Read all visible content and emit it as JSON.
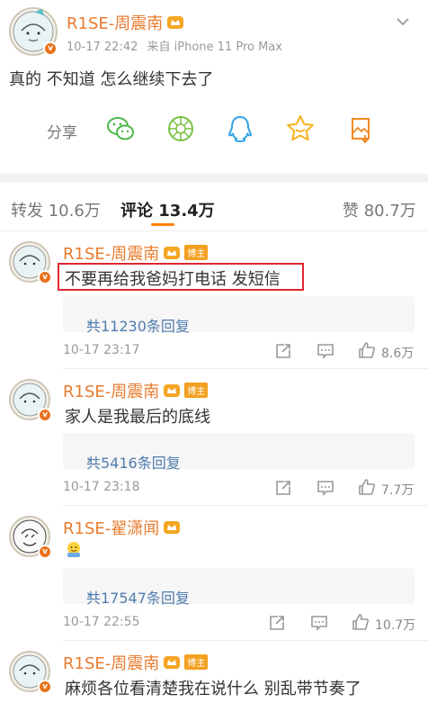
{
  "post": {
    "author": "R1SE-周震南",
    "time": "10-17 22:42",
    "source": "来自 iPhone 11 Pro Max",
    "text": "真的 不知道 怎么继续下去了",
    "share_label": "分享"
  },
  "tabs": {
    "repost": "转发 10.6万",
    "comments": "评论 13.4万",
    "likes": "赞 80.7万"
  },
  "colors": {
    "username": "#e97b2e",
    "reply_link": "#507daf",
    "highlight_border": "#e0262f",
    "host_tag": "#f3a020"
  },
  "comments": [
    {
      "author": "R1SE-周震南",
      "tag": "博主",
      "text": "不要再给我爸妈打电话 发短信",
      "replies": "共11230条回复",
      "time": "10-17 23:17",
      "likes": "8.6万",
      "highlighted": true
    },
    {
      "author": "R1SE-周震南",
      "tag": "博主",
      "text": "家人是我最后的底线",
      "replies": "共5416条回复",
      "time": "10-17 23:18",
      "likes": "7.7万"
    },
    {
      "author": "R1SE-翟潇闻",
      "text": "",
      "emoji": "hug-emoji",
      "replies": "共17547条回复",
      "time": "10-17 22:55",
      "likes": "10.7万"
    },
    {
      "author": "R1SE-周震南",
      "tag": "博主",
      "text": "麻烦各位看清楚我在说什么 别乱带节奏了"
    }
  ]
}
